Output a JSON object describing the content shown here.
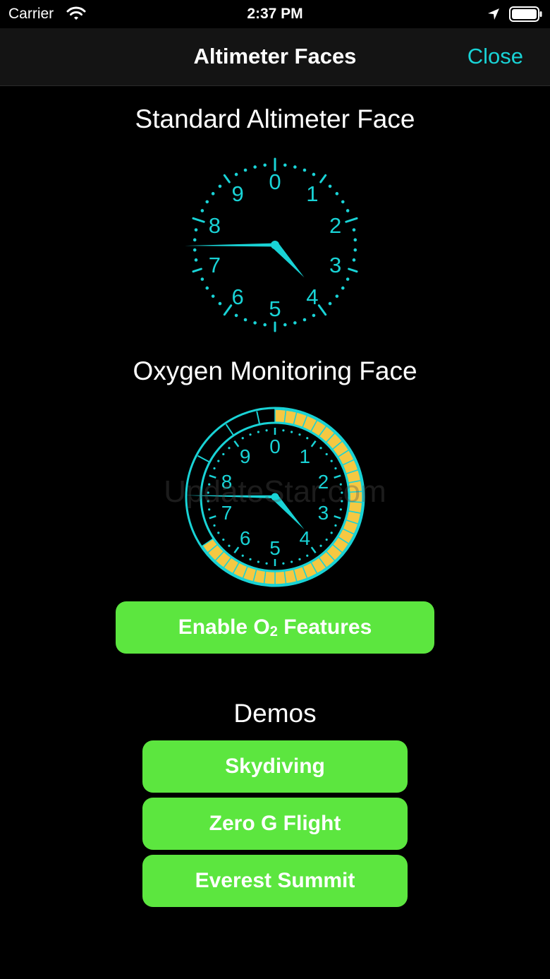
{
  "status_bar": {
    "carrier": "Carrier",
    "time": "2:37 PM"
  },
  "nav": {
    "title": "Altimeter Faces",
    "close_label": "Close"
  },
  "standard_face": {
    "title": "Standard Altimeter Face",
    "numerals": [
      "0",
      "1",
      "2",
      "3",
      "4",
      "5",
      "6",
      "7",
      "8",
      "9"
    ]
  },
  "oxygen_face": {
    "title": "Oxygen Monitoring Face",
    "numerals": [
      "0",
      "1",
      "2",
      "3",
      "4",
      "5",
      "6",
      "7",
      "8",
      "9"
    ]
  },
  "enable_button": {
    "prefix": "Enable O",
    "subscript": "2",
    "suffix": " Features"
  },
  "demos": {
    "title": "Demos",
    "items": [
      {
        "label": "Skydiving"
      },
      {
        "label": "Zero G Flight"
      },
      {
        "label": "Everest Summit"
      }
    ]
  },
  "watermark": "UpdateStar.com",
  "colors": {
    "accent": "#19d3d6",
    "button": "#5ce63f",
    "warning_band": "#f5c842",
    "background": "#000000"
  }
}
